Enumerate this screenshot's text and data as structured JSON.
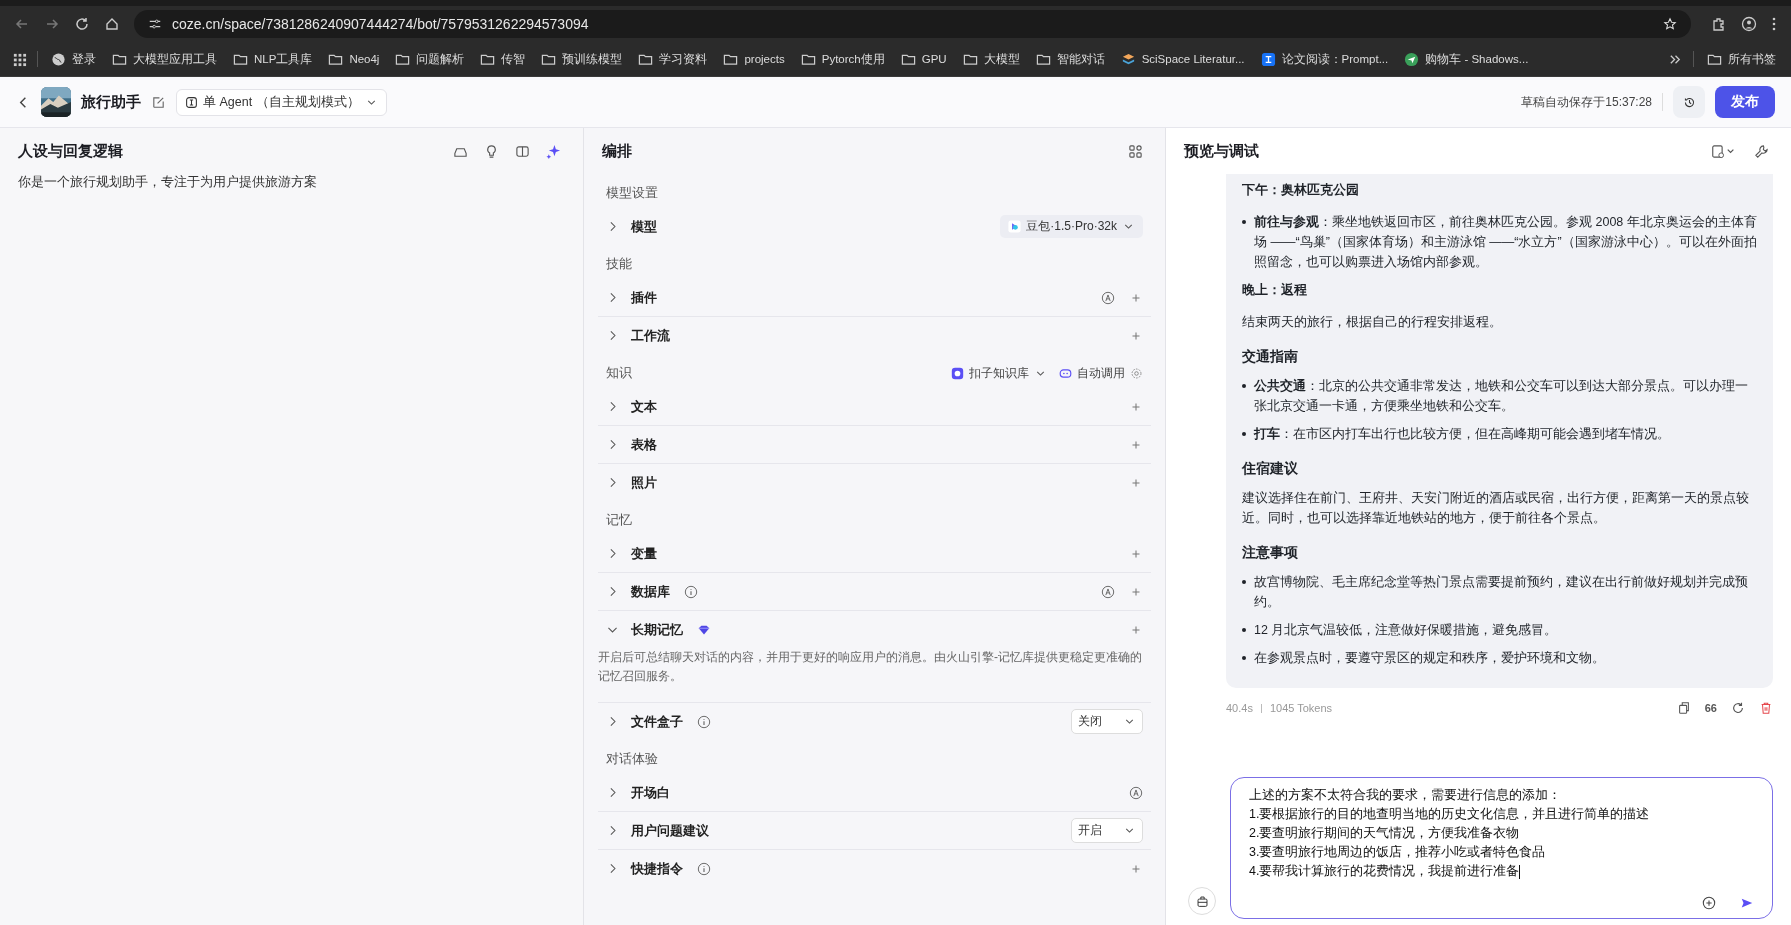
{
  "browser": {
    "url": "coze.cn/space/7381286240907444274/bot/7579531262294573094",
    "bookmarks": [
      {
        "kind": "globe",
        "label": "登录"
      },
      {
        "kind": "folder",
        "label": "大模型应用工具"
      },
      {
        "kind": "folder",
        "label": "NLP工具库"
      },
      {
        "kind": "folder",
        "label": "Neo4j"
      },
      {
        "kind": "folder",
        "label": "问题解析"
      },
      {
        "kind": "folder",
        "label": "传智"
      },
      {
        "kind": "folder",
        "label": "预训练模型"
      },
      {
        "kind": "folder",
        "label": "学习资料"
      },
      {
        "kind": "folder",
        "label": "projects"
      },
      {
        "kind": "folder",
        "label": "Pytorch使用"
      },
      {
        "kind": "folder",
        "label": "GPU"
      },
      {
        "kind": "folder",
        "label": "大模型"
      },
      {
        "kind": "folder",
        "label": "智能对话"
      },
      {
        "kind": "site",
        "label": "SciSpace Literatur..."
      },
      {
        "kind": "zhi",
        "label": "论文阅读：Prompt..."
      },
      {
        "kind": "plane",
        "label": "购物车 - Shadows..."
      }
    ],
    "all_bookmarks": "所有书签"
  },
  "header": {
    "title": "旅行助手",
    "mode": "单 Agent （自主规划模式）",
    "autosave": "草稿自动保存于15:37:28",
    "publish": "发布"
  },
  "persona": {
    "title": "人设与回复逻辑",
    "text": "你是一个旅行规划助手，专注于为用户提供旅游方案"
  },
  "arrange": {
    "title": "编排",
    "sections": [
      {
        "title": "模型设置",
        "items": [
          {
            "label": "模型",
            "expanded": false,
            "model": "豆包·1.5·Pro·32k"
          }
        ]
      },
      {
        "title": "技能",
        "items": [
          {
            "label": "插件",
            "expanded": false,
            "auto": true,
            "add": true
          },
          {
            "label": "工作流",
            "expanded": false,
            "add": true
          }
        ]
      },
      {
        "title": "知识",
        "source": "扣子知识库",
        "call": "自动调用",
        "items": [
          {
            "label": "文本",
            "expanded": false,
            "add": true
          },
          {
            "label": "表格",
            "expanded": false,
            "add": true
          },
          {
            "label": "照片",
            "expanded": false,
            "add": true
          }
        ]
      },
      {
        "title": "记忆",
        "items": [
          {
            "label": "变量",
            "expanded": false,
            "add": true
          },
          {
            "label": "数据库",
            "expanded": false,
            "info": true,
            "auto": true,
            "add": true
          },
          {
            "label": "长期记忆",
            "expanded": true,
            "premium": true,
            "add": true,
            "description": "开启后可总结聊天对话的内容，并用于更好的响应用户的消息。由火山引擎-记忆库提供更稳定更准确的记忆召回服务。"
          },
          {
            "label": "文件盒子",
            "expanded": false,
            "info": true,
            "select": "关闭"
          }
        ]
      },
      {
        "title": "对话体验",
        "items": [
          {
            "label": "开场白",
            "expanded": false,
            "auto": true
          },
          {
            "label": "用户问题建议",
            "expanded": false,
            "select": "开启"
          },
          {
            "label": "快捷指令",
            "expanded": false,
            "info": true,
            "add": true
          }
        ]
      }
    ]
  },
  "preview": {
    "title": "预览与调试",
    "blocks": [
      {
        "kind": "subheading",
        "text": "下午：奥林匹克公园"
      },
      {
        "kind": "bullet",
        "text": "**前往与参观**：乘坐地铁返回市区，前往奥林匹克公园。参观 2008 年北京奥运会的主体育场 ——“鸟巢”（国家体育场）和主游泳馆 ——“水立方”（国家游泳中心）。可以在外面拍照留念，也可以购票进入场馆内部参观。"
      },
      {
        "kind": "subheading",
        "text": "晚上：返程"
      },
      {
        "kind": "paragraph",
        "text": "结束两天的旅行，根据自己的行程安排返程。"
      },
      {
        "kind": "heading",
        "text": "交通指南"
      },
      {
        "kind": "bullet",
        "text": "**公共交通**：北京的公共交通非常发达，地铁和公交车可以到达大部分景点。可以办理一张北京交通一卡通，方便乘坐地铁和公交车。"
      },
      {
        "kind": "bullet",
        "text": "**打车**：在市区内打车出行也比较方便，但在高峰期可能会遇到堵车情况。"
      },
      {
        "kind": "heading",
        "text": "住宿建议"
      },
      {
        "kind": "paragraph",
        "text": "建议选择住在前门、王府井、天安门附近的酒店或民宿，出行方便，距离第一天的景点较近。同时，也可以选择靠近地铁站的地方，便于前往各个景点。"
      },
      {
        "kind": "heading",
        "text": "注意事项"
      },
      {
        "kind": "bullet",
        "text": "故宫博物院、毛主席纪念堂等热门景点需要提前预约，建议在出行前做好规划并完成预约。"
      },
      {
        "kind": "bullet",
        "text": "12 月北京气温较低，注意做好保暖措施，避免感冒。"
      },
      {
        "kind": "bullet",
        "text": "在参观景点时，要遵守景区的规定和秩序，爱护环境和文物。"
      }
    ],
    "duration": "40.4s",
    "tokens": "1045 Tokens",
    "quote": "66",
    "input": "上述的方案不太符合我的要求，需要进行信息的添加：\n1.要根据旅行的目的地查明当地的历史文化信息，并且进行简单的描述\n2.要查明旅行期间的天气情况，方便我准备衣物\n3.要查明旅行地周边的饭店，推荐小吃或者特色食品\n4.要帮我计算旅行的花费情况，我提前进行准备"
  }
}
